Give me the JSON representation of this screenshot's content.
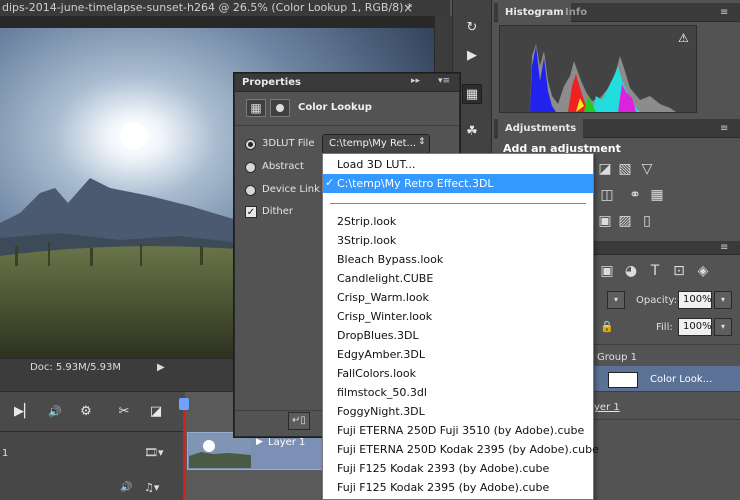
{
  "document": {
    "tab_title": "dips-2014-june-timelapse-sunset-h264 @ 26.5% (Color Lookup 1, RGB/8) *",
    "close_glyph": "×",
    "doc_size": "Doc: 5.93M/5.93M",
    "status_arrow": "▶"
  },
  "timeline": {
    "buttons": [
      "▶▏",
      "🔊",
      "⚙",
      "✂",
      "◪"
    ],
    "track_label": "1",
    "clip_label": "Layer 1",
    "clip_arrow": "▶",
    "film_glyph": "🎞▾",
    "audio_glyph": "🔊",
    "music_glyph": "♫▾"
  },
  "dock": {
    "icons": [
      "history-icon",
      "play-actions-icon",
      "properties-icon",
      "brush-icon"
    ],
    "glyphs": [
      "↻",
      "▶",
      "▦",
      "☘"
    ]
  },
  "histogram_panel": {
    "tabs": [
      "Histogram",
      "Info"
    ],
    "warning": "⚠",
    "menu": "≡"
  },
  "adjustments_panel": {
    "tab": "Adjustments",
    "title": "Add an adjustment",
    "icon_glyphs": [
      "◪",
      "▧",
      "▽",
      "◫",
      "⚭",
      "▦",
      "▣",
      "▨",
      "▯"
    ],
    "menu": "≡"
  },
  "layers_panel": {
    "opacity_label": "Opacity:",
    "opacity_value": "100%",
    "fill_label": "Fill:",
    "fill_value": "100%",
    "blend_dropdown": "▾",
    "filter_icons": [
      "▣",
      "◕",
      "T",
      "⊡",
      "◈"
    ],
    "lock_glyph": "🔒",
    "rows": [
      {
        "name": "Group 1"
      },
      {
        "name": "Color Look..."
      },
      {
        "name": "yer 1"
      }
    ]
  },
  "properties_panel": {
    "title": "Properties",
    "collapse": "▸▸",
    "menu": "▾≡",
    "heading": "Color Lookup",
    "options": [
      {
        "label": "3DLUT File",
        "selected": true
      },
      {
        "label": "Abstract",
        "selected": false
      },
      {
        "label": "Device Link",
        "selected": false
      }
    ],
    "dither_label": "Dither",
    "dither_checked": true,
    "lut_select_value": "C:\\temp\\My Ret...",
    "lut_select_arrow": "⇕",
    "bottom_buttons": [
      "↵▯",
      "↶",
      "◉",
      "↺",
      "🗑"
    ]
  },
  "lut_dropdown": {
    "items": [
      "Load 3D LUT...",
      "C:\\temp\\My Retro Effect.3DL",
      "2Strip.look",
      "3Strip.look",
      "Bleach Bypass.look",
      "Candlelight.CUBE",
      "Crisp_Warm.look",
      "Crisp_Winter.look",
      "DropBlues.3DL",
      "EdgyAmber.3DL",
      "FallColors.look",
      "filmstock_50.3dl",
      "FoggyNight.3DL",
      "Fuji ETERNA 250D Fuji 3510 (by Adobe).cube",
      "Fuji ETERNA 250D Kodak 2395 (by Adobe).cube",
      "Fuji F125 Kodak 2393 (by Adobe).cube",
      "Fuji F125 Kodak 2395 (by Adobe).cube"
    ],
    "selected_index": 1,
    "check": "✓"
  }
}
